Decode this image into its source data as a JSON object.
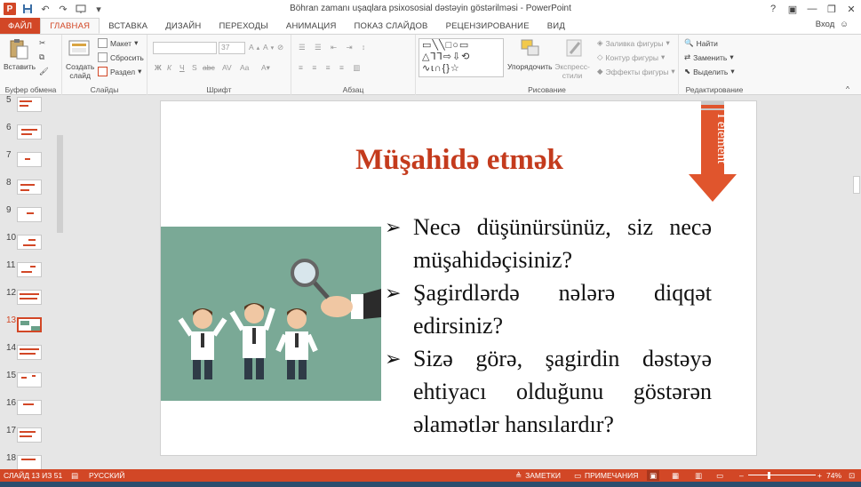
{
  "window": {
    "title": "Böhran zamanı uşaqlara psixososial dəstəyin göstərilməsi - PowerPoint",
    "help": "?",
    "minimize": "—",
    "restore": "❐",
    "close": "✕",
    "ribbon_display": "▣",
    "login": "Вход"
  },
  "tabs": {
    "file": "ФАЙЛ",
    "home": "ГЛАВНАЯ",
    "insert": "ВСТАВКА",
    "design": "ДИЗАЙН",
    "transitions": "ПЕРЕХОДЫ",
    "animation": "АНИМАЦИЯ",
    "slideshow": "ПОКАЗ СЛАЙДОВ",
    "review": "РЕЦЕНЗИРОВАНИЕ",
    "view": "ВИД"
  },
  "ribbon": {
    "clipboard": {
      "label": "Буфер обмена",
      "paste": "Вставить"
    },
    "slides": {
      "label": "Слайды",
      "new_slide": "Создать слайд",
      "layout": "Макет",
      "reset": "Сбросить",
      "section": "Раздел"
    },
    "font": {
      "label": "Шрифт",
      "size": "37",
      "bold": "Ж",
      "italic": "К",
      "underline": "Ч",
      "strike": "S",
      "shadow": "abc",
      "spacing": "AV",
      "case": "Aa"
    },
    "paragraph": {
      "label": "Абзац"
    },
    "drawing": {
      "label": "Рисование",
      "arrange": "Упорядочить",
      "quick_styles": "Экспресс-стили",
      "fill": "Заливка фигуры",
      "outline": "Контур фигуры",
      "effects": "Эффекты фигуры"
    },
    "editing": {
      "label": "Редактирование",
      "find": "Найти",
      "replace": "Заменить",
      "select": "Выделить"
    }
  },
  "thumbnails": [
    {
      "num": "5"
    },
    {
      "num": "6"
    },
    {
      "num": "7"
    },
    {
      "num": "8"
    },
    {
      "num": "9"
    },
    {
      "num": "10"
    },
    {
      "num": "11"
    },
    {
      "num": "12"
    },
    {
      "num": "13",
      "selected": true
    },
    {
      "num": "14"
    },
    {
      "num": "15"
    },
    {
      "num": "16"
    },
    {
      "num": "17"
    },
    {
      "num": "18"
    }
  ],
  "slide": {
    "title": "Müşahidə etmək",
    "arrow_label": "I element",
    "bullet_mark": "➢",
    "bullets": [
      "Necə düşünürsünüz, siz necə müşahidəçisiniz?",
      "Şagirdlərdə nələrə diqqət edirsiniz?",
      "Sizə görə, şagirdin dəstəyə ehtiyacı olduğunu göstərən əlamətlər hansılardır?"
    ]
  },
  "status": {
    "slide_counter": "СЛАЙД 13 ИЗ 51",
    "language": "РУССКИЙ",
    "notes": "ЗАМЕТКИ",
    "comments": "ПРИМЕЧАНИЯ",
    "zoom": "74%",
    "zoom_minus": "–",
    "zoom_plus": "+"
  },
  "colors": {
    "accent": "#d24726",
    "title_red": "#c43b1d",
    "picture_bg": "#7aa996"
  }
}
